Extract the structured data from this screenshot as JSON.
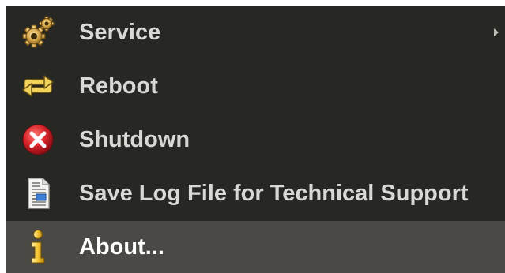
{
  "menu": {
    "items": [
      {
        "label": "Service",
        "icon": "gears-icon",
        "has_submenu": true,
        "selected": false
      },
      {
        "label": "Reboot",
        "icon": "reboot-arrows-icon",
        "has_submenu": false,
        "selected": false
      },
      {
        "label": "Shutdown",
        "icon": "shutdown-x-icon",
        "has_submenu": false,
        "selected": false
      },
      {
        "label": "Save Log File for Technical Support",
        "icon": "log-file-icon",
        "has_submenu": false,
        "selected": false
      },
      {
        "label": "About...",
        "icon": "info-icon",
        "has_submenu": false,
        "selected": true
      }
    ]
  },
  "colors": {
    "menu_background": "#272724",
    "selected_background": "#4a4946",
    "label_color": "#d8d8d4",
    "shutdown_red": "#d9252b",
    "reboot_yellow": "#f2d35a",
    "info_yellow": "#f5c431"
  }
}
